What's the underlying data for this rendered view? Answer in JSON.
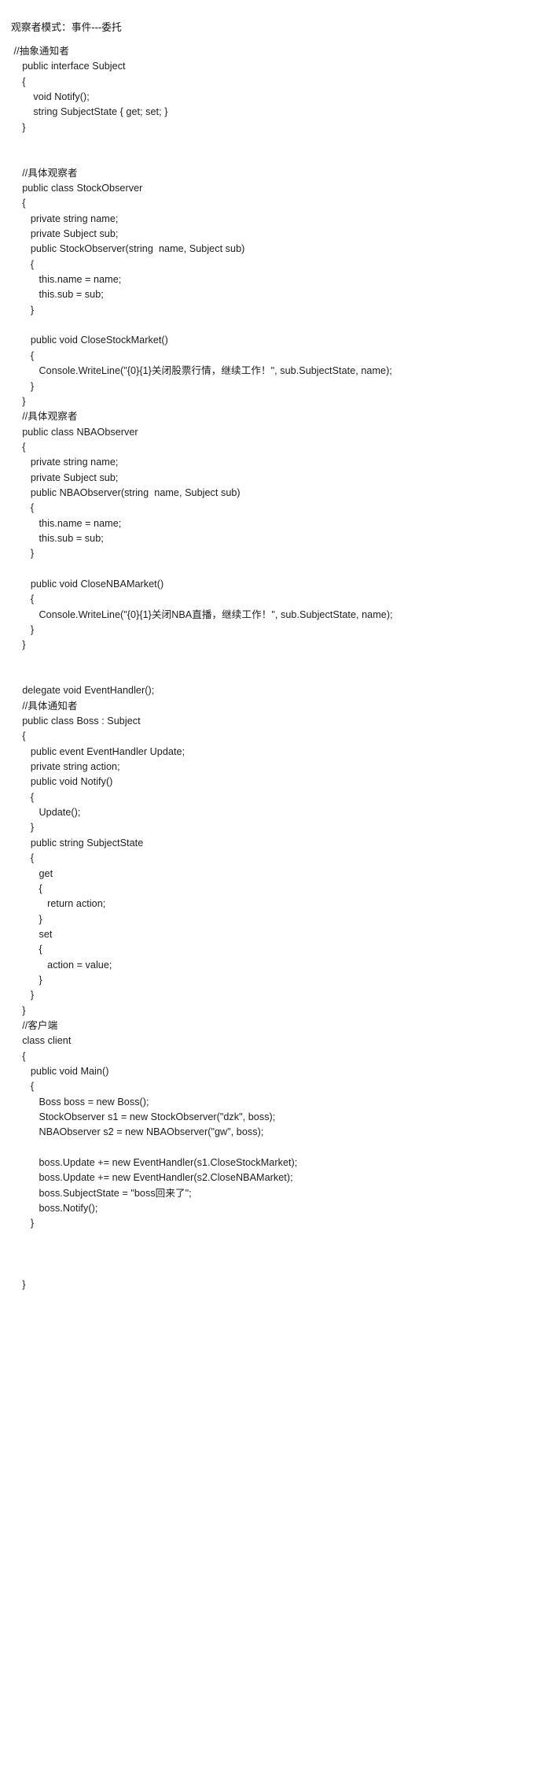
{
  "document": {
    "title_line": "观察者模式：事件---委托",
    "language": "csharp",
    "background_color": "#ffffff",
    "text_color": "#1c1c1c"
  },
  "code": {
    "lines": [
      " //抽象通知者",
      "    public interface Subject",
      "    {",
      "        void Notify();",
      "        string SubjectState { get; set; }",
      "    }",
      "",
      "",
      "    //具体观察者",
      "    public class StockObserver",
      "    {",
      "       private string name;",
      "       private Subject sub;",
      "       public StockObserver(string  name, Subject sub)",
      "       {",
      "          this.name = name;",
      "          this.sub = sub;",
      "       }",
      "",
      "       public void CloseStockMarket()",
      "       {",
      "          Console.WriteLine(\"{0}{1}关闭股票行情，继续工作！\", sub.SubjectState, name);",
      "       }",
      "    }",
      "    //具体观察者",
      "    public class NBAObserver",
      "    {",
      "       private string name;",
      "       private Subject sub;",
      "       public NBAObserver(string  name, Subject sub)",
      "       {",
      "          this.name = name;",
      "          this.sub = sub;",
      "       }",
      "",
      "       public void CloseNBAMarket()",
      "       {",
      "          Console.WriteLine(\"{0}{1}关闭NBA直播，继续工作！\", sub.SubjectState, name);",
      "       }",
      "    }",
      "",
      "",
      "    delegate void EventHandler();",
      "    //具体通知者",
      "    public class Boss : Subject",
      "    {",
      "       public event EventHandler Update;",
      "       private string action;",
      "       public void Notify()",
      "       {",
      "          Update();",
      "       }",
      "       public string SubjectState",
      "       {",
      "          get",
      "          {",
      "             return action;",
      "          }",
      "          set",
      "          {",
      "             action = value;",
      "          }",
      "       }",
      "    }",
      "    //客户端",
      "    class client",
      "    {",
      "       public void Main()",
      "       {",
      "          Boss boss = new Boss();",
      "          StockObserver s1 = new StockObserver(\"dzk\", boss);",
      "          NBAObserver s2 = new NBAObserver(\"gw\", boss);",
      "",
      "          boss.Update += new EventHandler(s1.CloseStockMarket);",
      "          boss.Update += new EventHandler(s2.CloseNBAMarket);",
      "          boss.SubjectState = \"boss回来了\";",
      "          boss.Notify();",
      "       }",
      "",
      "",
      "",
      "    }"
    ]
  }
}
